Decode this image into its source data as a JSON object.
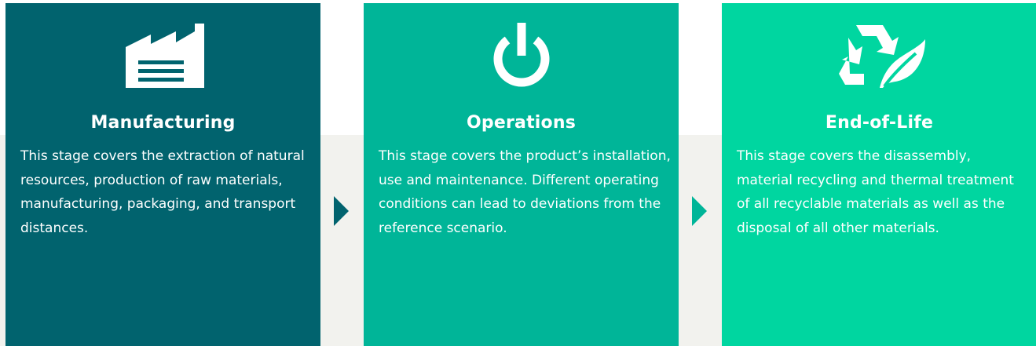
{
  "colors": {
    "manufacturing": "#01636e",
    "operations": "#00b598",
    "end_of_life": "#00d6a0",
    "band": "#f2f2ee",
    "arrow_1": "#01636e",
    "arrow_2": "#00b598"
  },
  "stages": [
    {
      "icon": "factory-icon",
      "title": "Manufacturing",
      "description": "This stage covers the extraction of natural resources, production of raw materials, manufacturing, packaging, and transport distances."
    },
    {
      "icon": "power-icon",
      "title": "Operations",
      "description": "This stage covers the product’s installation, use and maintenance. Different operating conditions can lead to deviations from the reference scenario."
    },
    {
      "icon": "recycle-leaf-icon",
      "title": "End-of-Life",
      "description": "This stage covers the disassembly, material recycling and thermal treatment of all recyclable materials as well as the disposal of all other materials."
    }
  ]
}
